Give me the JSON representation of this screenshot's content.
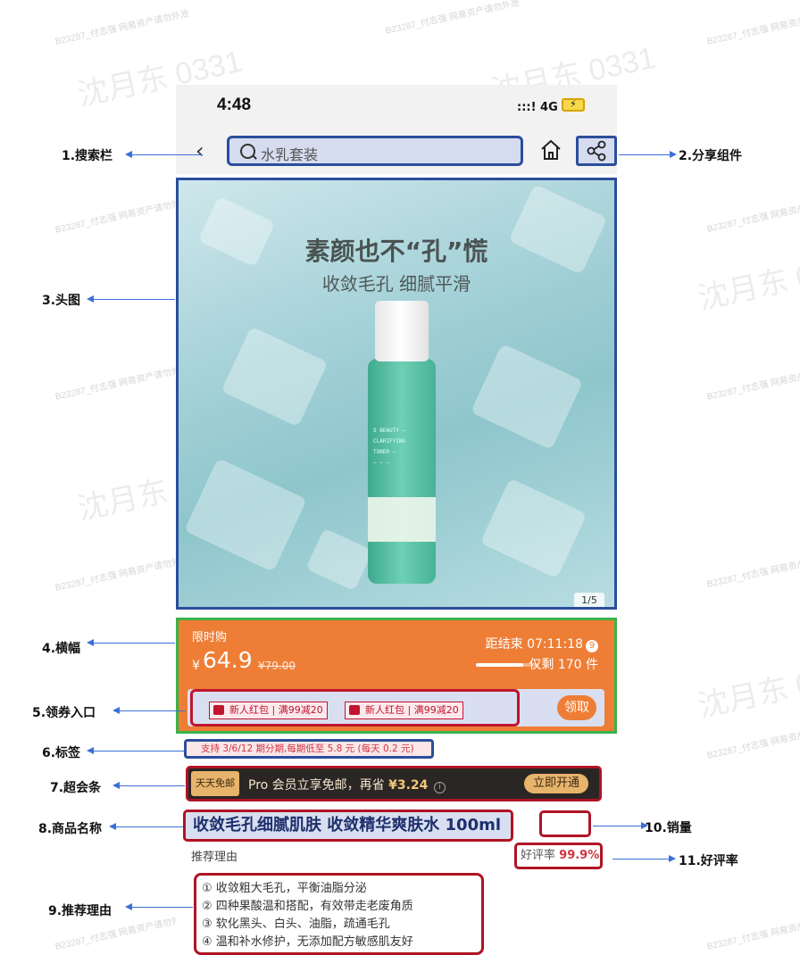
{
  "watermark": {
    "name_text": "沈月东 0331",
    "id_text": "B23287_付志强 网易资产请勿外泄"
  },
  "status_bar": {
    "time": "4:48",
    "signal": ":::! 4G"
  },
  "nav": {
    "back_icon": "chevron-left-icon",
    "search_placeholder": "水乳套装",
    "home_icon": "home-icon",
    "share_icon": "share-icon"
  },
  "hero": {
    "headline": "素颜也不“孔”慌",
    "subheadline": "收敛毛孔 细腻平滑",
    "pager": "1/5"
  },
  "banner": {
    "label": "限时购",
    "currency": "¥",
    "price": "64.9",
    "original_price": "¥79.00",
    "countdown": "距结束 07:11:18",
    "countdown_badge": "9",
    "stock_text": "仅剩 170 件",
    "stock_fraction": 0.75,
    "coupons": [
      "新人红包 | 满99减20",
      "新人红包 | 满99减20"
    ],
    "claim_button": "领取"
  },
  "tag": {
    "text": "支持 3/6/12 期分期,每期低至 5.8 元 (每天 0.2 元)"
  },
  "vip_bar": {
    "badge": "天天免邮",
    "text": "Pro 会员立享免邮，再省",
    "amount": "¥3.24",
    "info_icon": "i",
    "button": "立即开通"
  },
  "product": {
    "name": "收敛毛孔细腻肌肤 收敛精华爽肤水 100ml",
    "rec_title": "推荐理由",
    "rating_label": "好评率",
    "rating_value": "99.9%",
    "reasons": [
      "① 收敛粗大毛孔，平衡油脂分泌",
      "② 四种果酸温和搭配，有效带走老废角质",
      "③ 软化黑头、白头、油脂，疏通毛孔",
      "④ 温和补水修护，无添加配方敏感肌友好"
    ]
  },
  "annotations": {
    "search": "1.搜索栏",
    "share": "2.分享组件",
    "hero": "3.头图",
    "banner": "4.横幅",
    "coupon": "5.领券入口",
    "tag": "6.标签",
    "vip": "7.超会条",
    "name": "8.商品名称",
    "reason": "9.推荐理由",
    "sales": "10.销量",
    "rating": "11.好评率"
  },
  "colors": {
    "annotation_blue": "#2b4e9c",
    "annotation_red": "#b01325",
    "annotation_green": "#3bb24a",
    "banner_orange": "#ee7e36",
    "arrow_blue": "#3a6fd8"
  }
}
